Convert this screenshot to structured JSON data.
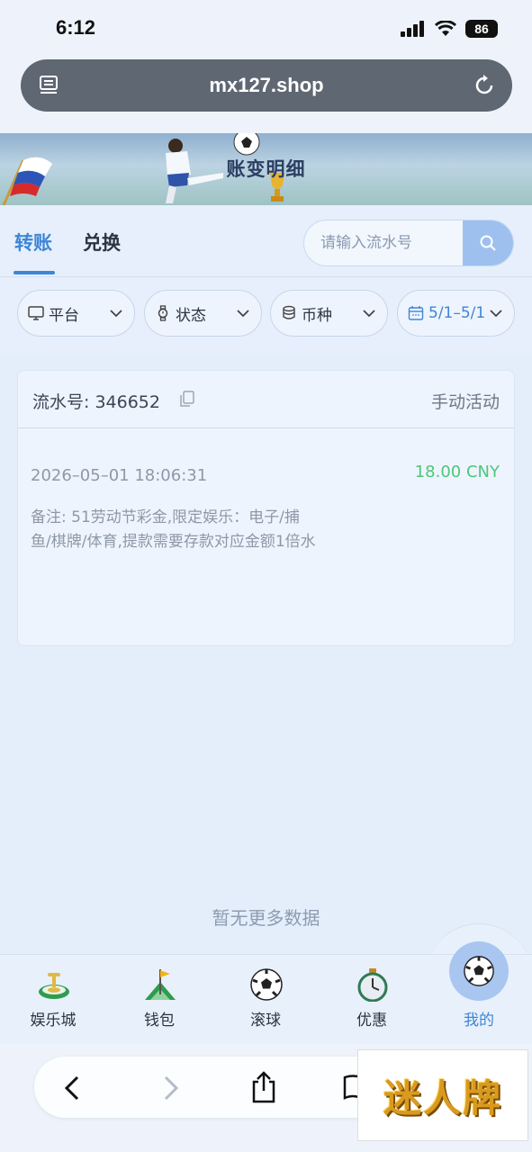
{
  "status_bar": {
    "time": "6:12",
    "battery": "86"
  },
  "browser": {
    "url": "mx127.shop"
  },
  "banner": {
    "title": "账变明细"
  },
  "tabs": [
    {
      "label": "转账",
      "active": true
    },
    {
      "label": "兑换",
      "active": false
    }
  ],
  "search": {
    "placeholder": "请输入流水号",
    "value": ""
  },
  "filters": [
    {
      "icon": "monitor-icon",
      "label": "平台"
    },
    {
      "icon": "watch-icon",
      "label": "状态"
    },
    {
      "icon": "coins-icon",
      "label": "币种"
    },
    {
      "icon": "calendar-icon",
      "label": "5/1–5/1"
    }
  ],
  "record": {
    "serial": "流水号: 346652",
    "type": "手动活动",
    "datetime": "2026–05–01 18:06:31",
    "amount": "18.00 CNY",
    "remark": "备注: 51劳动节彩金,限定娱乐：电子/捕鱼/棋牌/体育,提款需要存款对应金额1倍水"
  },
  "empty_text": "暂无更多数据",
  "nav": [
    {
      "icon": "casino-icon",
      "label": "娱乐城",
      "active": false
    },
    {
      "icon": "flag-icon",
      "label": "钱包",
      "active": false
    },
    {
      "icon": "soccer-ball-icon",
      "label": "滚球",
      "active": false
    },
    {
      "icon": "stopwatch-icon",
      "label": "优惠",
      "active": false
    },
    {
      "icon": "soccer-ball-icon",
      "label": "我的",
      "active": true
    }
  ],
  "watermark": "迷人牌",
  "colors": {
    "accent": "#3d86d6",
    "amount": "#4cc77a",
    "background": "#e4eefb"
  }
}
